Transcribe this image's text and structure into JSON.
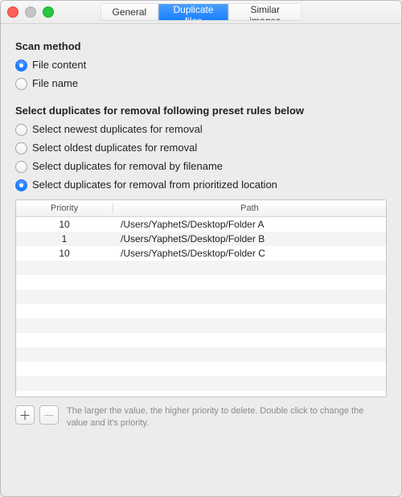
{
  "tabs": {
    "general": "General",
    "duplicate": "Duplicate files",
    "similar": "Similar images"
  },
  "scan": {
    "title": "Scan method",
    "opt_content": "File content",
    "opt_name": "File name"
  },
  "rules": {
    "title": "Select duplicates for removal following preset rules below",
    "opt_newest": "Select newest duplicates for removal",
    "opt_oldest": "Select oldest duplicates for removal",
    "opt_filename": "Select duplicates for removal by filename",
    "opt_location": "Select duplicates for removal from prioritized location"
  },
  "table": {
    "header_priority": "Priority",
    "header_path": "Path",
    "rows": [
      {
        "priority": "10",
        "path": "/Users/YaphetS/Desktop/Folder A"
      },
      {
        "priority": "1",
        "path": "/Users/YaphetS/Desktop/Folder B"
      },
      {
        "priority": "10",
        "path": "/Users/YaphetS/Desktop/Folder C"
      }
    ]
  },
  "footer": {
    "add_glyph": "＋",
    "remove_glyph": "－",
    "hint": "The larger the value, the higher priority to delete. Double click to change the value and it's priority."
  }
}
